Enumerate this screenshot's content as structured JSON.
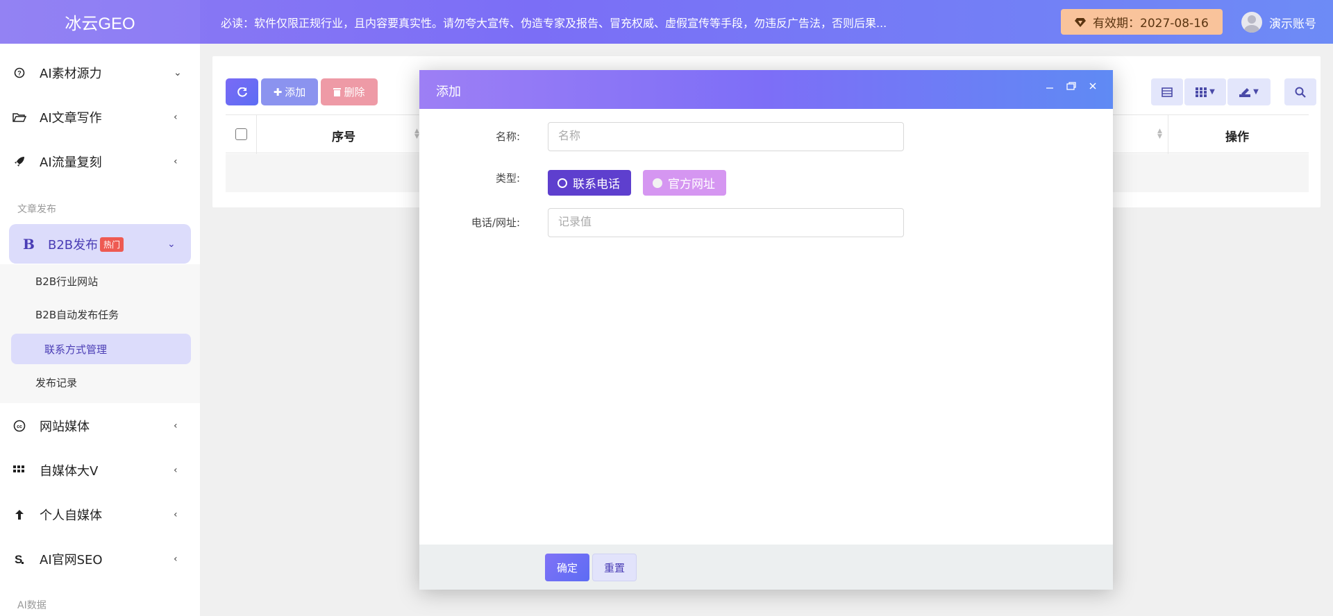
{
  "header": {
    "logo": "冰云GEO",
    "notice": "必读：软件仅限正规行业，且内容要真实性。请勿夸大宣传、伪造专家及报告、冒充权威、虚假宣传等手段，勿违反广告法，否则后果...",
    "expire_label": "有效期：2027-08-16",
    "user_name": "演示账号"
  },
  "sidebar": {
    "items": [
      {
        "label": "AI素材源力",
        "icon": "question-circle-icon",
        "arrow": "⌄"
      },
      {
        "label": "AI文章写作",
        "icon": "folder-open-icon",
        "arrow": "‹"
      },
      {
        "label": "AI流量复刻",
        "icon": "rocket-icon",
        "arrow": "‹"
      }
    ],
    "section_publish": "文章发布",
    "b2b": {
      "label": "B2B发布",
      "badge": "热门",
      "icon_letter": "B",
      "arrow": "⌄"
    },
    "submenu": [
      {
        "label": "B2B行业网站"
      },
      {
        "label": "B2B自动发布任务"
      },
      {
        "label": "联系方式管理"
      },
      {
        "label": "发布记录"
      }
    ],
    "items2": [
      {
        "label": "网站媒体",
        "icon": "cc-icon",
        "arrow": "‹"
      },
      {
        "label": "自媒体大V",
        "icon": "grid-icon",
        "arrow": "‹"
      },
      {
        "label": "个人自媒体",
        "icon": "arrow-up-icon",
        "arrow": "‹"
      },
      {
        "label": "AI官网SEO",
        "icon": "seo-s-icon",
        "arrow": "‹"
      }
    ],
    "section_data": "AI数据"
  },
  "toolbar": {
    "add_label": "添加",
    "delete_label": "删除"
  },
  "table": {
    "col_index": "序号",
    "col_action": "操作"
  },
  "modal": {
    "title": "添加",
    "name_label": "名称:",
    "name_placeholder": "名称",
    "type_label": "类型:",
    "type_options": [
      "联系电话",
      "官方网址"
    ],
    "type_selected": "联系电话",
    "value_label": "电话/网址:",
    "value_placeholder": "记录值",
    "ok_label": "确定",
    "reset_label": "重置"
  },
  "colors": {
    "accent": "#7b6ef6",
    "selected_radio": "#5e3fce",
    "unselected_radio": "#d596f1",
    "badge_hot": "#ee5a52",
    "expire_bg": "#f9c39b"
  }
}
